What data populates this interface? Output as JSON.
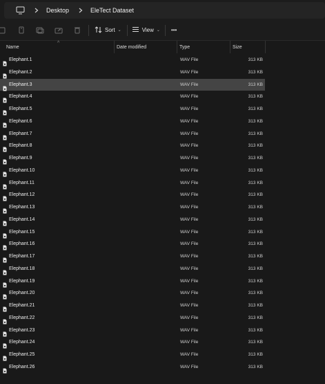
{
  "breadcrumb": {
    "items": [
      "Desktop",
      "EleTect Dataset"
    ]
  },
  "commandbar": {
    "sort_label": "Sort",
    "view_label": "View",
    "more_label": "•••"
  },
  "columns": {
    "name": "Name",
    "date_modified": "Date modified",
    "type": "Type",
    "size": "Size"
  },
  "files": [
    {
      "name": "Elephant.1",
      "type": "WAV File",
      "size": "313 KB"
    },
    {
      "name": "Elephant.2",
      "type": "WAV File",
      "size": "313 KB"
    },
    {
      "name": "Elephant.3",
      "type": "WAV File",
      "size": "313 KB",
      "selected": true
    },
    {
      "name": "Elephant.4",
      "type": "WAV File",
      "size": "313 KB"
    },
    {
      "name": "Elephant.5",
      "type": "WAV File",
      "size": "313 KB"
    },
    {
      "name": "Elephant.6",
      "type": "WAV File",
      "size": "313 KB"
    },
    {
      "name": "Elephant.7",
      "type": "WAV File",
      "size": "313 KB"
    },
    {
      "name": "Elephant.8",
      "type": "WAV File",
      "size": "313 KB"
    },
    {
      "name": "Elephant.9",
      "type": "WAV File",
      "size": "313 KB"
    },
    {
      "name": "Elephant.10",
      "type": "WAV File",
      "size": "313 KB"
    },
    {
      "name": "Elephant.11",
      "type": "WAV File",
      "size": "313 KB"
    },
    {
      "name": "Elephant.12",
      "type": "WAV File",
      "size": "313 KB"
    },
    {
      "name": "Elephant.13",
      "type": "WAV File",
      "size": "313 KB"
    },
    {
      "name": "Elephant.14",
      "type": "WAV File",
      "size": "313 KB"
    },
    {
      "name": "Elephant.15",
      "type": "WAV File",
      "size": "313 KB"
    },
    {
      "name": "Elephant.16",
      "type": "WAV File",
      "size": "313 KB"
    },
    {
      "name": "Elephant.17",
      "type": "WAV File",
      "size": "313 KB"
    },
    {
      "name": "Elephant.18",
      "type": "WAV File",
      "size": "313 KB"
    },
    {
      "name": "Elephant.19",
      "type": "WAV File",
      "size": "313 KB"
    },
    {
      "name": "Elephant.20",
      "type": "WAV File",
      "size": "313 KB"
    },
    {
      "name": "Elephant.21",
      "type": "WAV File",
      "size": "313 KB"
    },
    {
      "name": "Elephant.22",
      "type": "WAV File",
      "size": "313 KB"
    },
    {
      "name": "Elephant.23",
      "type": "WAV File",
      "size": "313 KB"
    },
    {
      "name": "Elephant.24",
      "type": "WAV File",
      "size": "313 KB"
    },
    {
      "name": "Elephant.25",
      "type": "WAV File",
      "size": "313 KB"
    },
    {
      "name": "Elephant.26",
      "type": "WAV File",
      "size": "313 KB"
    }
  ],
  "colors": {
    "background": "#191919",
    "selected_row": "#444444",
    "file_icon": "#e8e8e8"
  }
}
